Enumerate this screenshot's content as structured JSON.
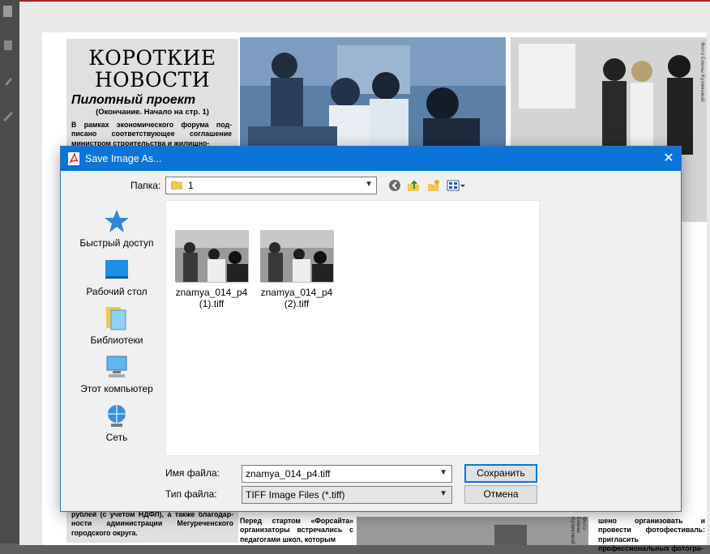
{
  "newspaper": {
    "headline_line1": "КОРОТКИЕ",
    "headline_line2": "НОВОСТИ",
    "subhead": "Пилотный проект",
    "note": "(Окончание. Начало на стр. 1)",
    "para1": "В рамках экономического форума под-писано соответствующее соглашение министром строительства и жилищно-",
    "bottom_left": "рублей (с учетом НДФЛ), а также благодар-ности администрации Мегуреченского городского округа.",
    "mid_text": "Перед стартом «Форсайта» организаторы встречались с педагогами школ, которым",
    "right_text": "шено организовать и провести фотофестиваль: пригласить профессиональных фотогра-",
    "photo_credit_1": "Фото Елены Куликовой",
    "photo_credit_2": "Фото Елены Куликовой"
  },
  "dialog": {
    "title": "Save Image As...",
    "close_glyph": "✕",
    "folder_label": "Папка:",
    "folder_value": "1",
    "places": [
      {
        "label": "Быстрый доступ",
        "icon": "quick-access-icon"
      },
      {
        "label": "Рабочий стол",
        "icon": "desktop-icon"
      },
      {
        "label": "Библиотеки",
        "icon": "libraries-icon"
      },
      {
        "label": "Этот компьютер",
        "icon": "this-pc-icon"
      },
      {
        "label": "Сеть",
        "icon": "network-icon"
      }
    ],
    "files": [
      {
        "name_line1": "znamya_014_p4",
        "name_line2": "(1).tiff"
      },
      {
        "name_line1": "znamya_014_p4",
        "name_line2": "(2).tiff"
      }
    ],
    "filename_label": "Имя файла:",
    "filename_value": "znamya_014_p4.tiff",
    "filetype_label": "Тип файла:",
    "filetype_value": "TIFF Image Files (*.tiff)",
    "save_label": "Сохранить",
    "cancel_label": "Отмена",
    "accent_color": "#0a74d8"
  }
}
